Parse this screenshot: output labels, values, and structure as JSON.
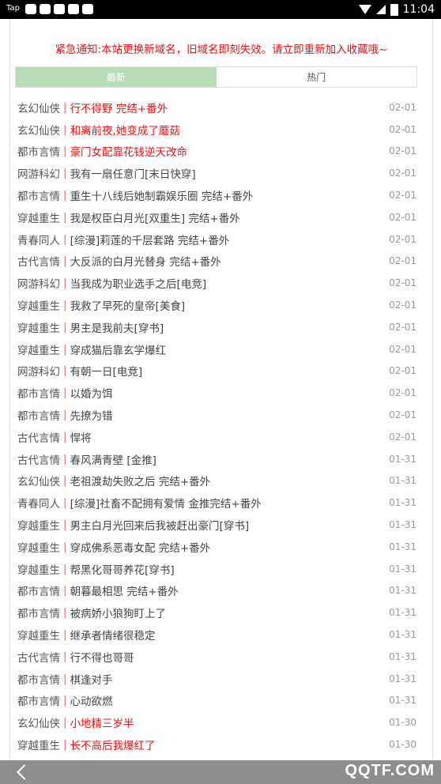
{
  "status_bar": {
    "app_label": "Tap",
    "time": "11:04"
  },
  "notice": "紧急通知:本站更换新域名，旧域名即刻失效。请立即重新加入收藏哦~",
  "tabs": [
    {
      "label": "最新",
      "active": true
    },
    {
      "label": "热门",
      "active": false
    }
  ],
  "items": [
    {
      "category": "玄幻仙侠",
      "title": "行不得野 完结+番外",
      "date": "02-01",
      "highlight": true
    },
    {
      "category": "玄幻仙侠",
      "title": "和离前夜,她变成了蘑菇",
      "date": "02-01",
      "highlight": true
    },
    {
      "category": "都市言情",
      "title": "豪门女配靠花钱逆天改命",
      "date": "02-01",
      "highlight": true
    },
    {
      "category": "网游科幻",
      "title": "我有一扇任意门[末日快穿]",
      "date": "02-01",
      "highlight": false
    },
    {
      "category": "都市言情",
      "title": "重生十八线后她制霸娱乐圈 完结+番外",
      "date": "02-01",
      "highlight": false
    },
    {
      "category": "穿越重生",
      "title": "我是权臣白月光[双重生] 完结+番外",
      "date": "02-01",
      "highlight": false
    },
    {
      "category": "青春同人",
      "title": "[综漫]莉莲的千层套路 完结+番外",
      "date": "02-01",
      "highlight": false
    },
    {
      "category": "古代言情",
      "title": "大反派的白月光替身 完结+番外",
      "date": "02-01",
      "highlight": false
    },
    {
      "category": "网游科幻",
      "title": "当我成为职业选手之后[电竞]",
      "date": "02-01",
      "highlight": false
    },
    {
      "category": "穿越重生",
      "title": "我救了早死的皇帝[美食]",
      "date": "02-01",
      "highlight": false
    },
    {
      "category": "穿越重生",
      "title": "男主是我前夫[穿书]",
      "date": "02-01",
      "highlight": false
    },
    {
      "category": "穿越重生",
      "title": "穿成猫后靠玄学爆红",
      "date": "02-01",
      "highlight": false
    },
    {
      "category": "网游科幻",
      "title": "有朝一日[电竞]",
      "date": "02-01",
      "highlight": false
    },
    {
      "category": "都市言情",
      "title": "以婚为饵",
      "date": "02-01",
      "highlight": false
    },
    {
      "category": "都市言情",
      "title": "先撩为错",
      "date": "02-01",
      "highlight": false
    },
    {
      "category": "古代言情",
      "title": "悍将",
      "date": "02-01",
      "highlight": false
    },
    {
      "category": "古代言情",
      "title": "春风满青壁 [金推]",
      "date": "01-31",
      "highlight": false
    },
    {
      "category": "玄幻仙侠",
      "title": "老祖渡劫失败之后 完结+番外",
      "date": "01-31",
      "highlight": false
    },
    {
      "category": "青春同人",
      "title": "[综漫]社畜不配拥有爱情 金推完结+番外",
      "date": "01-31",
      "highlight": false
    },
    {
      "category": "穿越重生",
      "title": "男主白月光回来后我被赶出豪门[穿书]",
      "date": "01-31",
      "highlight": false
    },
    {
      "category": "穿越重生",
      "title": "穿成佛系恶毒女配 完结+番外",
      "date": "01-31",
      "highlight": false
    },
    {
      "category": "穿越重生",
      "title": "帮黑化哥哥养花[穿书]",
      "date": "01-31",
      "highlight": false
    },
    {
      "category": "都市言情",
      "title": "朝暮最相思 完结+番外",
      "date": "01-31",
      "highlight": false
    },
    {
      "category": "都市言情",
      "title": "被病娇小狼狗盯上了",
      "date": "01-31",
      "highlight": false
    },
    {
      "category": "穿越重生",
      "title": "继承者情绪很稳定",
      "date": "01-31",
      "highlight": false
    },
    {
      "category": "古代言情",
      "title": "行不得也哥哥",
      "date": "01-31",
      "highlight": false
    },
    {
      "category": "都市言情",
      "title": "棋逢对手",
      "date": "01-31",
      "highlight": false
    },
    {
      "category": "都市言情",
      "title": "心动欲燃",
      "date": "01-31",
      "highlight": false
    },
    {
      "category": "玄幻仙侠",
      "title": "小地精三岁半",
      "date": "01-30",
      "highlight": true
    },
    {
      "category": "穿越重生",
      "title": "长不高后我爆红了",
      "date": "01-30",
      "highlight": true
    }
  ],
  "separator": "|",
  "watermark": "QQTF.COM",
  "colors": {
    "highlight": "#ee1111",
    "tab_active": "#b7ddb6"
  }
}
